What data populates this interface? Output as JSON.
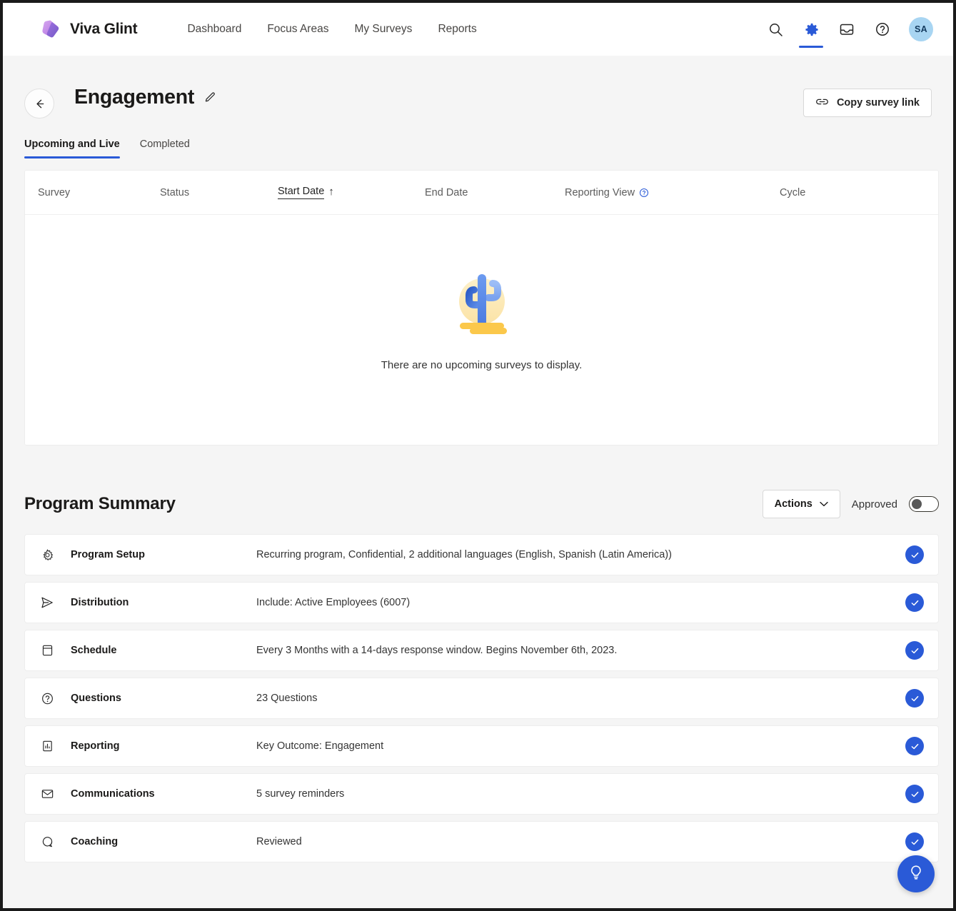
{
  "topnav": {
    "brand": "Viva Glint",
    "links": [
      {
        "label": "Dashboard"
      },
      {
        "label": "Focus Areas"
      },
      {
        "label": "My Surveys"
      },
      {
        "label": "Reports"
      }
    ],
    "icons": [
      {
        "name": "search-icon",
        "active": false
      },
      {
        "name": "gear-icon",
        "active": true
      },
      {
        "name": "inbox-icon",
        "active": false
      },
      {
        "name": "help-icon",
        "active": false
      }
    ],
    "avatar_initials": "SA",
    "accent_color": "#2a5ad7",
    "avatar_bg": "#a8d5f2"
  },
  "header": {
    "back_label": "Back",
    "title": "Engagement",
    "edit_label": "Edit name",
    "copy_button": "Copy survey link"
  },
  "tabs": [
    {
      "label": "Upcoming and Live",
      "selected": true
    },
    {
      "label": "Completed",
      "selected": false
    }
  ],
  "table": {
    "columns": [
      {
        "label": "Survey",
        "sorted": false,
        "help": false
      },
      {
        "label": "Status",
        "sorted": false,
        "help": false
      },
      {
        "label": "Start Date",
        "sorted": true,
        "sort_dir": "↑",
        "help": false
      },
      {
        "label": "End Date",
        "sorted": false,
        "help": false
      },
      {
        "label": "Reporting View",
        "sorted": false,
        "help": true
      },
      {
        "label": "Cycle",
        "sorted": false,
        "help": false
      }
    ],
    "empty_message": "There are no upcoming surveys to display.",
    "empty_illustration": "cactus-desert-illustration"
  },
  "summary": {
    "title": "Program Summary",
    "actions_label": "Actions",
    "approved_label": "Approved",
    "approved_on": false,
    "rows": [
      {
        "icon": "gear-icon",
        "label": "Program Setup",
        "value": "Recurring program, Confidential, 2 additional languages (English, Spanish (Latin America))",
        "complete": true
      },
      {
        "icon": "send-icon",
        "label": "Distribution",
        "value": "Include: Active Employees (6007)",
        "complete": true
      },
      {
        "icon": "calendar-icon",
        "label": "Schedule",
        "value": "Every 3 Months with a 14-days response window. Begins November 6th, 2023.",
        "complete": true
      },
      {
        "icon": "question-circle-icon",
        "label": "Questions",
        "value": "23 Questions",
        "complete": true
      },
      {
        "icon": "bar-chart-icon",
        "label": "Reporting",
        "value": "Key Outcome: Engagement",
        "complete": true
      },
      {
        "icon": "envelope-icon",
        "label": "Communications",
        "value": "5 survey reminders",
        "complete": true
      },
      {
        "icon": "chat-bubble-icon",
        "label": "Coaching",
        "value": "Reviewed",
        "complete": true
      }
    ]
  },
  "fab": {
    "name": "lightbulb-icon",
    "label": "Tips"
  }
}
